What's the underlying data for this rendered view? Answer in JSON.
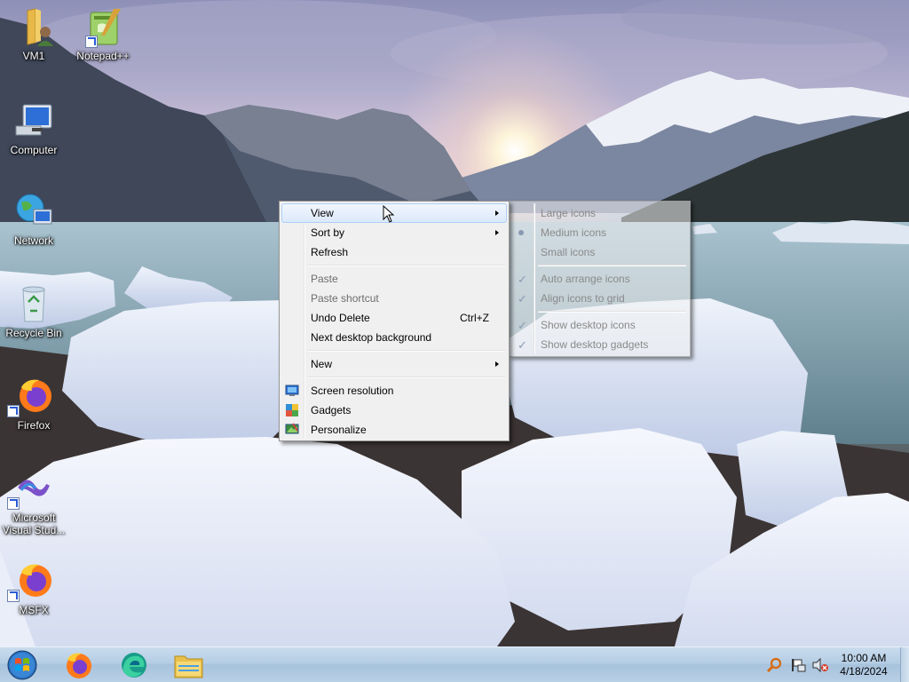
{
  "desktop_icons": [
    {
      "label": "VM1",
      "icon": "user-folder-icon"
    },
    {
      "label": "Notepad++",
      "icon": "notepadpp-icon"
    },
    {
      "label": "Computer",
      "icon": "computer-icon"
    },
    {
      "label": "Network",
      "icon": "network-icon"
    },
    {
      "label": "Recycle Bin",
      "icon": "recycle-bin-icon"
    },
    {
      "label": "Firefox",
      "icon": "firefox-icon"
    },
    {
      "label": "Microsoft Visual Stud...",
      "icon": "visual-studio-icon"
    },
    {
      "label": "MSFX",
      "icon": "firefox-icon"
    }
  ],
  "context_menu": {
    "view": "View",
    "sort_by": "Sort by",
    "refresh": "Refresh",
    "paste": "Paste",
    "paste_shortcut": "Paste shortcut",
    "undo_delete": "Undo Delete",
    "undo_delete_shortcut": "Ctrl+Z",
    "next_background": "Next desktop background",
    "new": "New",
    "screen_resolution": "Screen resolution",
    "gadgets": "Gadgets",
    "personalize": "Personalize"
  },
  "view_submenu": {
    "large_icons": "Large icons",
    "medium_icons": "Medium icons",
    "small_icons": "Small icons",
    "auto_arrange": "Auto arrange icons",
    "align_to_grid": "Align icons to grid",
    "show_desktop_icons": "Show desktop icons",
    "show_gadgets": "Show desktop gadgets"
  },
  "taskbar": {
    "apps": [
      "firefox-icon",
      "edge-icon",
      "file-explorer-icon"
    ],
    "tray_icons": [
      "search-icon",
      "action-center-flag-icon",
      "volume-muted-icon"
    ],
    "time": "10:00 AM",
    "date": "4/18/2024"
  },
  "colors": {
    "menu_bg": "#f0f0f0",
    "menu_hover": "#dce9fb",
    "taskbar": "#b5cde4"
  }
}
